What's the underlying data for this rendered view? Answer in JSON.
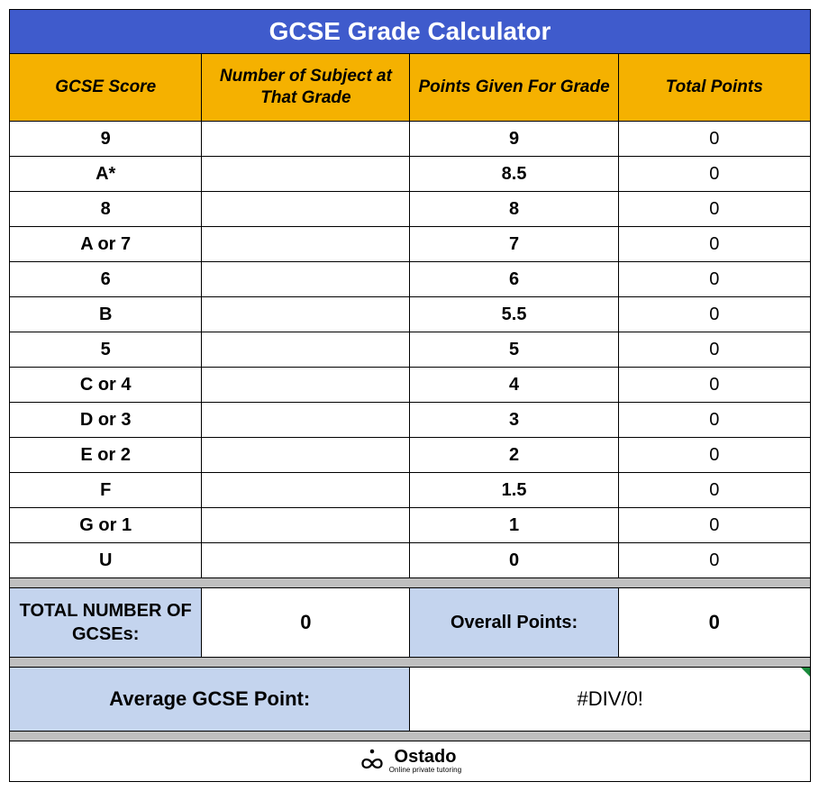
{
  "title": "GCSE Grade Calculator",
  "headers": {
    "score": "GCSE Score",
    "count": "Number of Subject at That Grade",
    "points": "Points Given For Grade",
    "total": "Total Points"
  },
  "rows": [
    {
      "score": "9",
      "count": "",
      "points": "9",
      "total": "0"
    },
    {
      "score": "A*",
      "count": "",
      "points": "8.5",
      "total": "0"
    },
    {
      "score": "8",
      "count": "",
      "points": "8",
      "total": "0"
    },
    {
      "score": "A or 7",
      "count": "",
      "points": "7",
      "total": "0"
    },
    {
      "score": "6",
      "count": "",
      "points": "6",
      "total": "0"
    },
    {
      "score": "B",
      "count": "",
      "points": "5.5",
      "total": "0"
    },
    {
      "score": "5",
      "count": "",
      "points": "5",
      "total": "0"
    },
    {
      "score": "C or 4",
      "count": "",
      "points": "4",
      "total": "0"
    },
    {
      "score": "D or 3",
      "count": "",
      "points": "3",
      "total": "0"
    },
    {
      "score": "E or 2",
      "count": "",
      "points": "2",
      "total": "0"
    },
    {
      "score": "F",
      "count": "",
      "points": "1.5",
      "total": "0"
    },
    {
      "score": "G or 1",
      "count": "",
      "points": "1",
      "total": "0"
    },
    {
      "score": "U",
      "count": "",
      "points": "0",
      "total": "0"
    }
  ],
  "summary": {
    "total_label": "TOTAL NUMBER OF GCSEs:",
    "total_value": "0",
    "overall_label": "Overall Points:",
    "overall_value": "0",
    "avg_label": "Average GCSE Point:",
    "avg_value": "#DIV/0!"
  },
  "logo": {
    "brand": "Ostado",
    "tagline": "Online private tutoring"
  },
  "chart_data": {
    "type": "table",
    "columns": [
      "GCSE Score",
      "Number of Subject at That Grade",
      "Points Given For Grade",
      "Total Points"
    ],
    "data": [
      [
        "9",
        "",
        9,
        0
      ],
      [
        "A*",
        "",
        8.5,
        0
      ],
      [
        "8",
        "",
        8,
        0
      ],
      [
        "A or 7",
        "",
        7,
        0
      ],
      [
        "6",
        "",
        6,
        0
      ],
      [
        "B",
        "",
        5.5,
        0
      ],
      [
        "5",
        "",
        5,
        0
      ],
      [
        "C or 4",
        "",
        4,
        0
      ],
      [
        "D or 3",
        "",
        3,
        0
      ],
      [
        "E or 2",
        "",
        2,
        0
      ],
      [
        "F",
        "",
        1.5,
        0
      ],
      [
        "G or 1",
        "",
        1,
        0
      ],
      [
        "U",
        "",
        0,
        0
      ]
    ],
    "summary": {
      "total_number_of_gcses": 0,
      "overall_points": 0,
      "average_gcse_point": "#DIV/0!"
    },
    "title": "GCSE Grade Calculator"
  }
}
